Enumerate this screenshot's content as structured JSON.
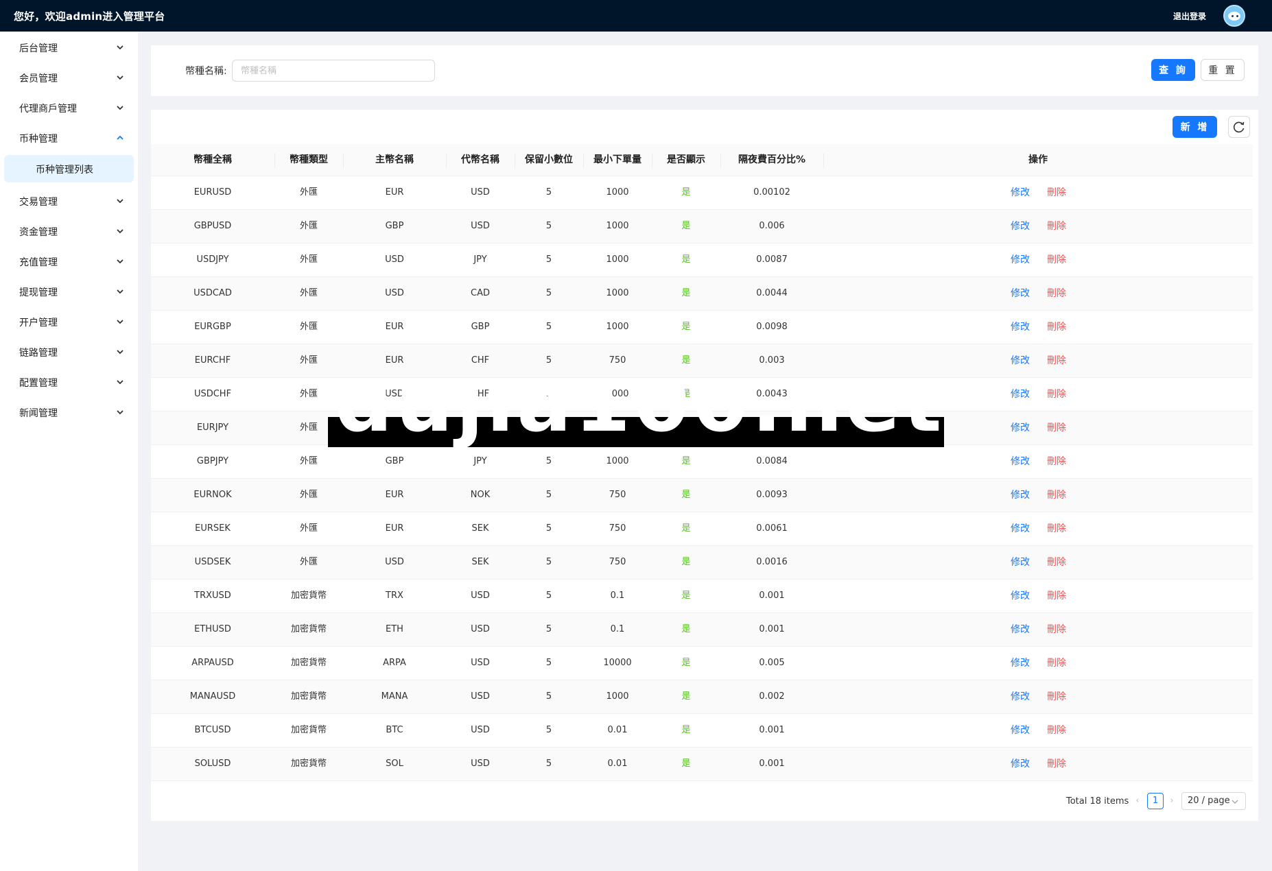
{
  "header": {
    "welcome": "您好，欢迎admin进入管理平台",
    "logout_label": "退出登录"
  },
  "sidebar": {
    "items": [
      {
        "label": "后台管理",
        "expanded": false
      },
      {
        "label": "会员管理",
        "expanded": false
      },
      {
        "label": "代理商戶管理",
        "expanded": false
      },
      {
        "label": "币种管理",
        "expanded": true
      },
      {
        "label": "交易管理",
        "expanded": false
      },
      {
        "label": "资金管理",
        "expanded": false
      },
      {
        "label": "充值管理",
        "expanded": false
      },
      {
        "label": "提现管理",
        "expanded": false
      },
      {
        "label": "开户管理",
        "expanded": false
      },
      {
        "label": "链路管理",
        "expanded": false
      },
      {
        "label": "配置管理",
        "expanded": false
      },
      {
        "label": "新闻管理",
        "expanded": false
      }
    ],
    "submenu_active": "币种管理列表"
  },
  "search": {
    "label": "幣種名稱:",
    "placeholder": "幣種名稱",
    "value": "",
    "query_label": "查 詢",
    "reset_label": "重 置"
  },
  "toolbar": {
    "add_label": "新 增"
  },
  "table": {
    "columns": [
      "幣種全稱",
      "幣種類型",
      "主幣名稱",
      "代幣名稱",
      "保留小數位",
      "最小下單量",
      "是否顯示",
      "隔夜費百分比%",
      "操作"
    ],
    "edit_label": "修改",
    "delete_label": "刪除",
    "rows": [
      {
        "full": "EURUSD",
        "type": "外匯",
        "base": "EUR",
        "quote": "USD",
        "decimals": "5",
        "min_order": "1000",
        "visible": "是",
        "overnight": "0.00102"
      },
      {
        "full": "GBPUSD",
        "type": "外匯",
        "base": "GBP",
        "quote": "USD",
        "decimals": "5",
        "min_order": "1000",
        "visible": "是",
        "overnight": "0.006"
      },
      {
        "full": "USDJPY",
        "type": "外匯",
        "base": "USD",
        "quote": "JPY",
        "decimals": "5",
        "min_order": "1000",
        "visible": "是",
        "overnight": "0.0087"
      },
      {
        "full": "USDCAD",
        "type": "外匯",
        "base": "USD",
        "quote": "CAD",
        "decimals": "5",
        "min_order": "1000",
        "visible": "是",
        "overnight": "0.0044"
      },
      {
        "full": "EURGBP",
        "type": "外匯",
        "base": "EUR",
        "quote": "GBP",
        "decimals": "5",
        "min_order": "1000",
        "visible": "是",
        "overnight": "0.0098"
      },
      {
        "full": "EURCHF",
        "type": "外匯",
        "base": "EUR",
        "quote": "CHF",
        "decimals": "5",
        "min_order": "750",
        "visible": "是",
        "overnight": "0.003"
      },
      {
        "full": "USDCHF",
        "type": "外匯",
        "base": "USD",
        "quote": "CHF",
        "decimals": "5",
        "min_order": "1000",
        "visible": "是",
        "overnight": "0.0043"
      },
      {
        "full": "EURJPY",
        "type": "外匯",
        "base": "",
        "quote": "",
        "decimals": "",
        "min_order": "",
        "visible": "",
        "overnight": ""
      },
      {
        "full": "GBPJPY",
        "type": "外匯",
        "base": "GBP",
        "quote": "JPY",
        "decimals": "5",
        "min_order": "1000",
        "visible": "是",
        "overnight": "0.0084"
      },
      {
        "full": "EURNOK",
        "type": "外匯",
        "base": "EUR",
        "quote": "NOK",
        "decimals": "5",
        "min_order": "750",
        "visible": "是",
        "overnight": "0.0093"
      },
      {
        "full": "EURSEK",
        "type": "外匯",
        "base": "EUR",
        "quote": "SEK",
        "decimals": "5",
        "min_order": "750",
        "visible": "是",
        "overnight": "0.0061"
      },
      {
        "full": "USDSEK",
        "type": "外匯",
        "base": "USD",
        "quote": "SEK",
        "decimals": "5",
        "min_order": "750",
        "visible": "是",
        "overnight": "0.0016"
      },
      {
        "full": "TRXUSD",
        "type": "加密貨幣",
        "base": "TRX",
        "quote": "USD",
        "decimals": "5",
        "min_order": "0.1",
        "visible": "是",
        "overnight": "0.001"
      },
      {
        "full": "ETHUSD",
        "type": "加密貨幣",
        "base": "ETH",
        "quote": "USD",
        "decimals": "5",
        "min_order": "0.1",
        "visible": "是",
        "overnight": "0.001"
      },
      {
        "full": "ARPAUSD",
        "type": "加密貨幣",
        "base": "ARPA",
        "quote": "USD",
        "decimals": "5",
        "min_order": "10000",
        "visible": "是",
        "overnight": "0.005"
      },
      {
        "full": "MANAUSD",
        "type": "加密貨幣",
        "base": "MANA",
        "quote": "USD",
        "decimals": "5",
        "min_order": "1000",
        "visible": "是",
        "overnight": "0.002"
      },
      {
        "full": "BTCUSD",
        "type": "加密貨幣",
        "base": "BTC",
        "quote": "USD",
        "decimals": "5",
        "min_order": "0.01",
        "visible": "是",
        "overnight": "0.001"
      },
      {
        "full": "SOLUSD",
        "type": "加密貨幣",
        "base": "SOL",
        "quote": "USD",
        "decimals": "5",
        "min_order": "0.01",
        "visible": "是",
        "overnight": "0.001"
      }
    ]
  },
  "pagination": {
    "total": "Total 18 items",
    "current_page": "1",
    "page_size": "20 / page"
  },
  "watermark": {
    "text": "dujia100.net"
  },
  "colors": {
    "header_bg": "#001529",
    "primary": "#1677ff",
    "danger": "#ff4d4f",
    "success": "#52c41a",
    "active_submenu_bg": "#e6f4ff"
  }
}
